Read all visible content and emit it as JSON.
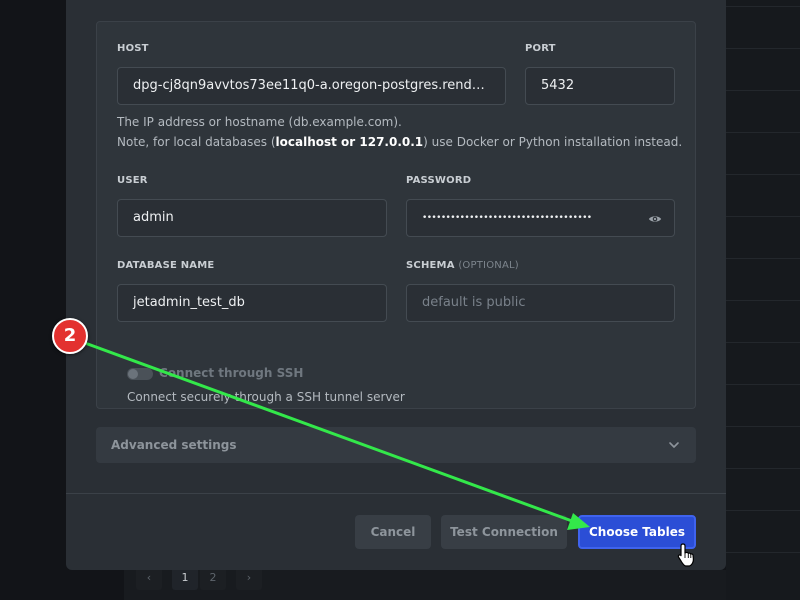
{
  "form": {
    "host": {
      "label": "HOST",
      "value": "dpg-cj8qn9avvtos73ee11q0-a.oregon-postgres.render.c..."
    },
    "port": {
      "label": "PORT",
      "value": "5432"
    },
    "host_help_line1": "The IP address or hostname (db.example.com).",
    "host_help_line2_pre": "Note, for local databases (",
    "host_help_line2_bold": "localhost or 127.0.0.1",
    "host_help_line2_post": ") use Docker or Python installation instead.",
    "user": {
      "label": "USER",
      "value": "admin"
    },
    "password": {
      "label": "PASSWORD",
      "value": "••••••••••••••••••••••••••••••••••••"
    },
    "database": {
      "label": "DATABASE NAME",
      "value": "jetadmin_test_db"
    },
    "schema": {
      "label": "SCHEMA",
      "optional": "(OPTIONAL)",
      "placeholder": "default is public"
    },
    "ssh": {
      "label": "Connect through SSH",
      "description": "Connect securely through a SSH tunnel server",
      "enabled": false
    }
  },
  "advanced": {
    "label": "Advanced settings"
  },
  "buttons": {
    "cancel": "Cancel",
    "test": "Test Connection",
    "choose": "Choose Tables"
  },
  "pagination": {
    "prev": "‹",
    "page1": "1",
    "page2": "2",
    "next": "›"
  },
  "annotation": {
    "step": "2",
    "arrow_color": "#33e84a"
  },
  "colors": {
    "primary": "#2b4ed6",
    "badge": "#e3312f"
  }
}
